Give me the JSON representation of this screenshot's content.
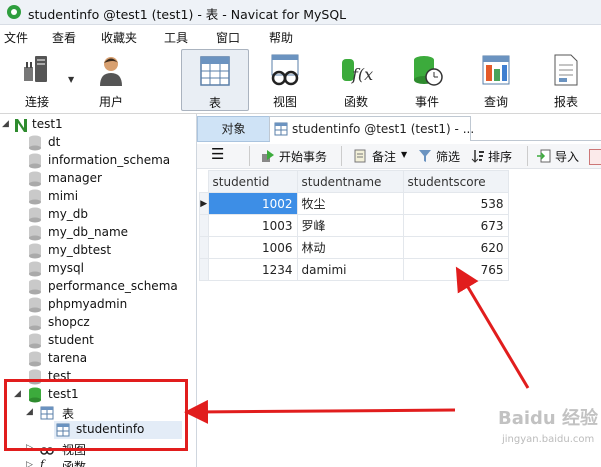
{
  "window": {
    "title": "studentinfo @test1 (test1) - 表 - Navicat for MySQL"
  },
  "menu": [
    "文件",
    "查看",
    "收藏夹",
    "工具",
    "窗口",
    "帮助"
  ],
  "toolbar": {
    "connect": "连接",
    "user": "用户",
    "table": "表",
    "view": "视图",
    "function": "函数",
    "event": "事件",
    "query": "查询",
    "report": "报表"
  },
  "tree": {
    "root": "test1",
    "databases": [
      "dt",
      "information_schema",
      "manager",
      "mimi",
      "my_db",
      "my_db_name",
      "my_dbtest",
      "mysql",
      "performance_schema",
      "phpmyadmin",
      "shopcz",
      "student",
      "tarena",
      "test"
    ],
    "open_db": "test1",
    "tables_folder": "表",
    "table": "studentinfo",
    "views_folder": "视图",
    "functions_folder": "函数"
  },
  "tabs": {
    "objects": "对象",
    "current": "studentinfo @test1 (test1) - ..."
  },
  "subtoolbar": {
    "begin_transaction": "开始事务",
    "notes": "备注",
    "filter": "筛选",
    "sort": "排序",
    "import": "导入"
  },
  "grid": {
    "columns": [
      "studentid",
      "studentname",
      "studentscore"
    ],
    "rows": [
      [
        "1002",
        "牧尘",
        "538"
      ],
      [
        "1003",
        "罗峰",
        "673"
      ],
      [
        "1006",
        "林动",
        "620"
      ],
      [
        "1234",
        "damimi",
        "765"
      ]
    ]
  },
  "watermark": {
    "brand": "Baidu 经验",
    "url": "jingyan.baidu.com"
  },
  "colors": {
    "annotation": "#e11d1d",
    "selection": "#3d8ee6",
    "db_icon": "#3cab3c"
  }
}
